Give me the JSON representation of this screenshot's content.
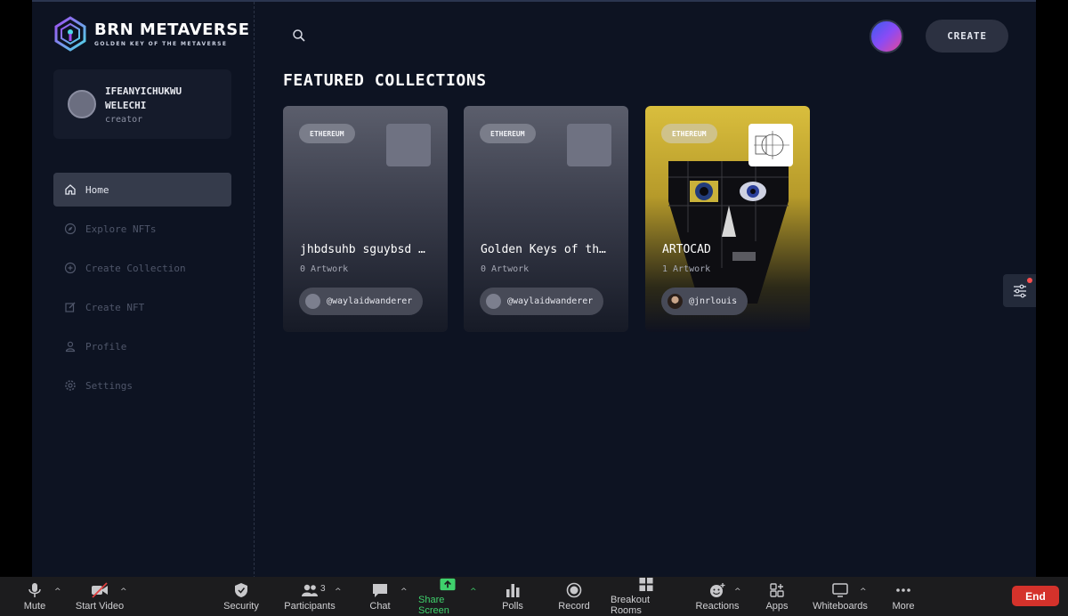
{
  "brand": {
    "title": "BRN METAVERSE",
    "subtitle": "GOLDEN KEY OF THE METAVERSE",
    "accent": "#5fd7e8"
  },
  "user": {
    "name": "IFEANYICHUKWU WELECHI",
    "role": "creator"
  },
  "nav": {
    "items": [
      {
        "label": "Home",
        "icon": "home-icon",
        "active": true
      },
      {
        "label": "Explore NFTs",
        "icon": "compass-icon"
      },
      {
        "label": "Create Collection",
        "icon": "plus-circle-icon"
      },
      {
        "label": "Create NFT",
        "icon": "edit-icon"
      },
      {
        "label": "Profile",
        "icon": "user-icon"
      },
      {
        "label": "Settings",
        "icon": "gear-icon"
      }
    ]
  },
  "header": {
    "create_label": "CREATE"
  },
  "main": {
    "section_title": "FEATURED COLLECTIONS",
    "collections": [
      {
        "chain": "ETHEREUM",
        "name": "jhbdsuhb sguybsd …",
        "count": "0 Artwork",
        "owner": "@waylaidwanderer"
      },
      {
        "chain": "ETHEREUM",
        "name": "Golden Keys of th…",
        "count": "0 Artwork",
        "owner": "@waylaidwanderer"
      },
      {
        "chain": "ETHEREUM",
        "name": "ARTOCAD",
        "count": "1 Artwork",
        "owner": "@jnrlouis"
      }
    ]
  },
  "zoom_toolbar": {
    "mute": "Mute",
    "start_video": "Start Video",
    "security": "Security",
    "participants": "Participants",
    "participants_count": "3",
    "chat": "Chat",
    "share_screen": "Share Screen",
    "polls": "Polls",
    "record": "Record",
    "breakout_rooms": "Breakout Rooms",
    "reactions": "Reactions",
    "apps": "Apps",
    "whiteboards": "Whiteboards",
    "more": "More",
    "end": "End",
    "end_color": "#d4322b",
    "share_color": "#3fd16c"
  }
}
